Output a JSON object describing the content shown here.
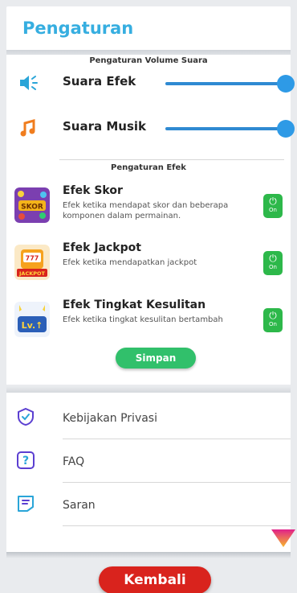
{
  "header": {
    "title": "Pengaturan"
  },
  "volume_section": {
    "title": "Pengaturan Volume Suara",
    "items": [
      {
        "label": "Suara Efek",
        "icon": "speaker-icon",
        "level": 1.0
      },
      {
        "label": "Suara Musik",
        "icon": "music-note-icon",
        "level": 1.0
      }
    ]
  },
  "effects_section": {
    "title": "Pengaturan Efek",
    "items": [
      {
        "title": "Efek Skor",
        "description": "Efek ketika mendapat skor dan beberapa komponen dalam permainan.",
        "image": "skor-image",
        "toggle": "On"
      },
      {
        "title": "Efek Jackpot",
        "description": "Efek ketika mendapatkan jackpot",
        "image": "jackpot-image",
        "toggle": "On"
      },
      {
        "title": "Efek Tingkat Kesulitan",
        "description": "Efek ketika tingkat kesulitan bertambah",
        "image": "level-up-image",
        "toggle": "On"
      }
    ],
    "save_label": "Simpan"
  },
  "menu": {
    "items": [
      {
        "label": "Kebijakan Privasi",
        "icon": "shield-check-icon"
      },
      {
        "label": "FAQ",
        "icon": "question-icon"
      },
      {
        "label": "Saran",
        "icon": "feedback-icon"
      }
    ]
  },
  "footer": {
    "back_label": "Kembali"
  },
  "colors": {
    "accent": "#36aee0",
    "slider": "#2e9ae6",
    "toggle_on": "#2db84a",
    "save": "#31c06b",
    "back": "#d9231d"
  }
}
